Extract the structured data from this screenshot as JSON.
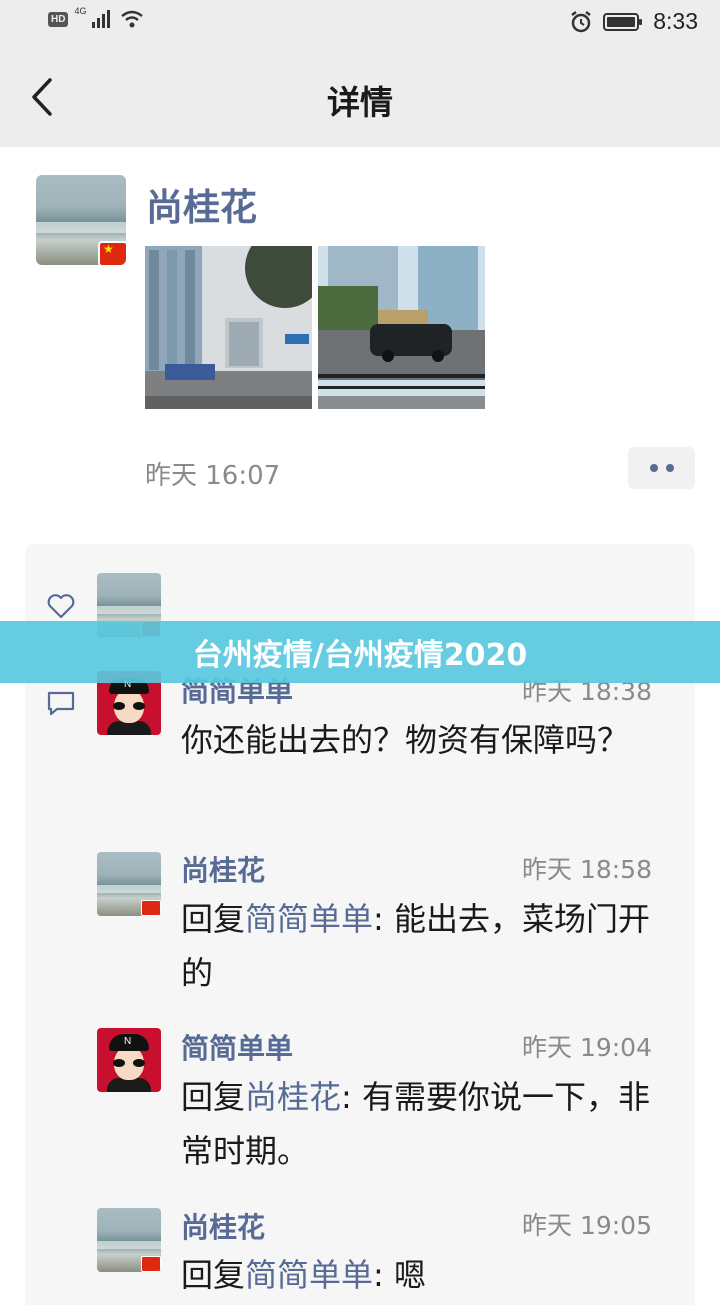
{
  "status_bar": {
    "network": "HD",
    "signal": "4G",
    "time": "8:33"
  },
  "header": {
    "title": "详情"
  },
  "post": {
    "author": "尚桂花",
    "time": "昨天 16:07"
  },
  "comments": [
    {
      "name": "简简单单",
      "time": "昨天 18:38",
      "text": "你还能出去的？物资有保障吗？"
    },
    {
      "name": "尚桂花",
      "time": "昨天 18:58",
      "prefix": "回复",
      "reply_to": "简简单单",
      "text": ": 能出去，菜场门开的"
    },
    {
      "name": "简简单单",
      "time": "昨天 19:04",
      "prefix": "回复",
      "reply_to": "尚桂花",
      "text": ": 有需要你说一下，非常时期。"
    },
    {
      "name": "尚桂花",
      "time": "昨天 19:05",
      "prefix": "回复",
      "reply_to": "简简单单",
      "text": ": 嗯"
    }
  ],
  "banner": {
    "text": "台州疫情/台州疫情2020"
  }
}
